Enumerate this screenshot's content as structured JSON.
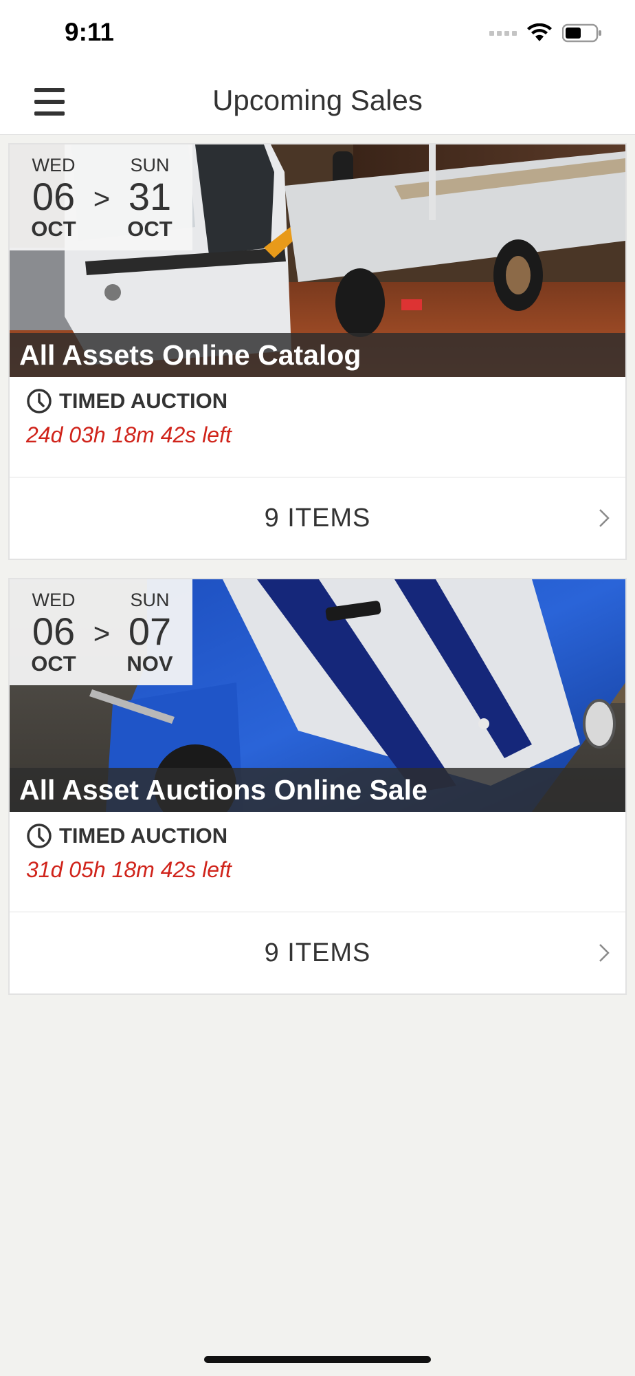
{
  "status_bar": {
    "time": "9:11"
  },
  "header": {
    "title": "Upcoming Sales"
  },
  "sales": [
    {
      "start": {
        "dow": "WED",
        "day": "06",
        "month": "OCT"
      },
      "end": {
        "dow": "SUN",
        "day": "31",
        "month": "OCT"
      },
      "separator": ">",
      "title": "All Assets Online Catalog",
      "image": "white-flatbed-truck",
      "type": "TIMED AUCTION",
      "time_left": "24d 03h 18m 42s left",
      "items": "9 ITEMS"
    },
    {
      "start": {
        "dow": "WED",
        "day": "06",
        "month": "OCT"
      },
      "end": {
        "dow": "SUN",
        "day": "07",
        "month": "NOV"
      },
      "separator": ">",
      "title": "All Asset Auctions Online Sale",
      "image": "blue-classic-roadster-with-white-stripes",
      "type": "TIMED AUCTION",
      "time_left": "31d 05h 18m 42s left",
      "items": "9 ITEMS"
    }
  ],
  "colors": {
    "time_left": "#d0241b",
    "title_overlay": "#2d2d2d",
    "background": "#f2f2ef"
  }
}
